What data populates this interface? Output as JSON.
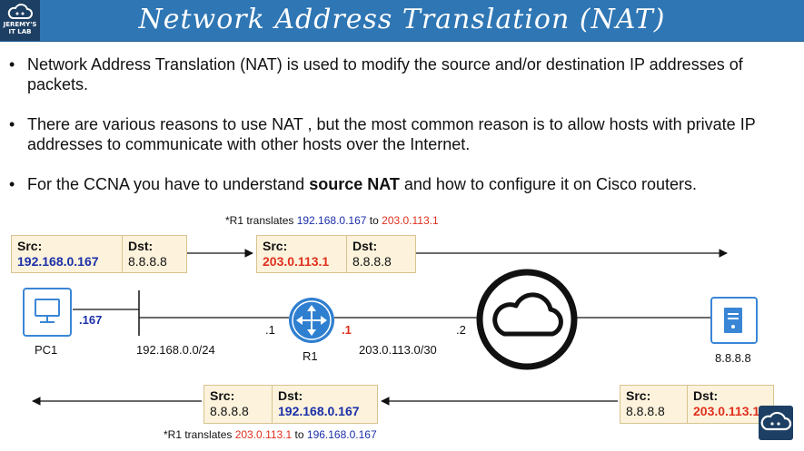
{
  "header": {
    "title": "Network Address Translation (NAT)",
    "logo_text_line1": "JEREMY'S",
    "logo_text_line2": "IT LAB"
  },
  "bullets": [
    "Network Address Translation (NAT) is used to modify the source and/or destination IP addresses of packets.",
    "There are various reasons to use NAT , but the most common reason is to allow hosts with private IP addresses to communicate with other hosts over the Internet.",
    {
      "before": "For the CCNA you have to understand ",
      "bold": "source NAT",
      "after": " and how to configure it on Cisco routers."
    }
  ],
  "diagram": {
    "top_note": {
      "prefix": "*R1 translates ",
      "from": "192.168.0.167",
      "mid": " to ",
      "to": "203.0.113.1"
    },
    "bottom_note": {
      "prefix": "*R1 translates ",
      "from": "203.0.113.1",
      "mid": " to ",
      "to": "196.168.0.167"
    },
    "packet_out_before": {
      "src_key": "Src:",
      "src_val": "192.168.0.167",
      "dst_key": "Dst:",
      "dst_val": "8.8.8.8"
    },
    "packet_out_after": {
      "src_key": "Src:",
      "src_val": "203.0.113.1",
      "dst_key": "Dst:",
      "dst_val": "8.8.8.8"
    },
    "packet_in_before": {
      "src_key": "Src:",
      "src_val": "8.8.8.8",
      "dst_key": "Dst:",
      "dst_val": "203.0.113.1"
    },
    "packet_in_after": {
      "src_key": "Src:",
      "src_val": "8.8.8.8",
      "dst_key": "Dst:",
      "dst_val": "192.168.0.167"
    },
    "pc1": {
      "name": "PC1",
      "host": ".167"
    },
    "lan_subnet": "192.168.0.0/24",
    "r1": {
      "name": "R1",
      "inside_if": ".1",
      "outside_if": ".1"
    },
    "wan_subnet": "203.0.113.0/30",
    "isp_if": ".2",
    "server": "8.8.8.8",
    "colors": {
      "blue": "#1b2fa8",
      "red": "#e0301e",
      "router": "#2f7fd0",
      "device": "#3a86d6",
      "packet_bg": "#fdf3dc"
    }
  }
}
